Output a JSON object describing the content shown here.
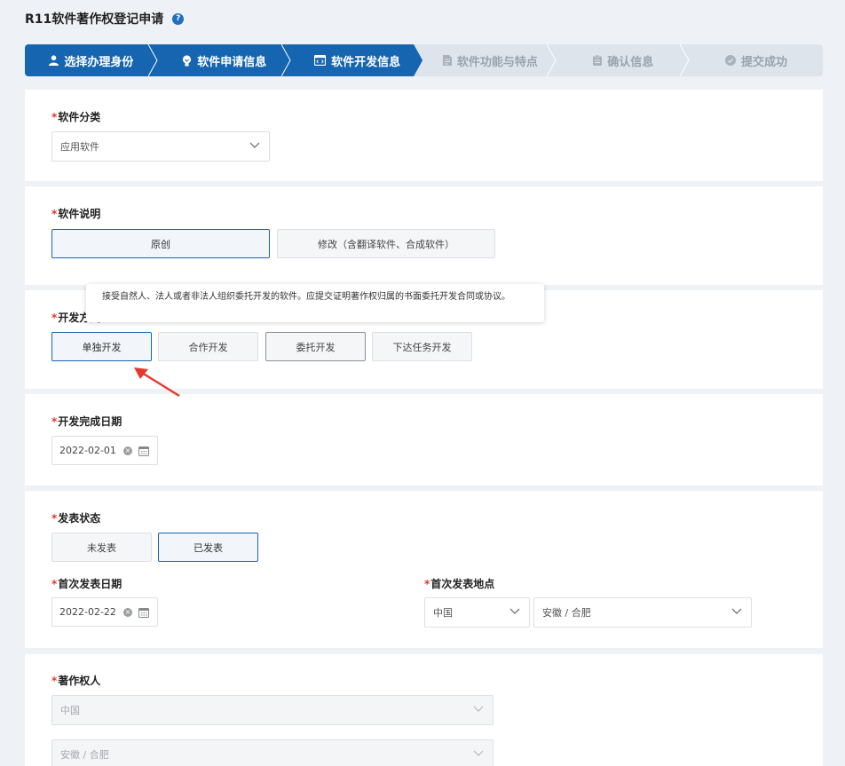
{
  "page": {
    "title": "R11软件著作权登记申请",
    "help_icon": "question-circle-icon"
  },
  "steps": [
    {
      "label": "选择办理身份",
      "icon": "user-icon",
      "state": "done"
    },
    {
      "label": "软件申请信息",
      "icon": "bulb-icon",
      "state": "done"
    },
    {
      "label": "软件开发信息",
      "icon": "code-window-icon",
      "state": "current"
    },
    {
      "label": "软件功能与特点",
      "icon": "document-icon",
      "state": "todo"
    },
    {
      "label": "确认信息",
      "icon": "clipboard-icon",
      "state": "todo"
    },
    {
      "label": "提交成功",
      "icon": "check-circle-icon",
      "state": "todo"
    }
  ],
  "sections": {
    "category": {
      "label": "软件分类",
      "value": "应用软件"
    },
    "description": {
      "label": "软件说明",
      "options": [
        "原创",
        "修改（含翻译软件、合成软件）"
      ],
      "selected": "原创"
    },
    "dev_method": {
      "label": "开发方式",
      "options": [
        "单独开发",
        "合作开发",
        "委托开发",
        "下达任务开发"
      ],
      "selected": "单独开发",
      "tooltip": "接受自然人、法人或者非法人组织委托开发的软件。应提交证明著作权归属的书面委托开发合同或协议。"
    },
    "completion_date": {
      "label": "开发完成日期",
      "value": "2022-02-01"
    },
    "publish_status": {
      "label": "发表状态",
      "options": [
        "未发表",
        "已发表"
      ],
      "selected": "已发表"
    },
    "first_publish_date": {
      "label": "首次发表日期",
      "value": "2022-02-22"
    },
    "first_publish_place": {
      "label": "首次发表地点",
      "country": "中国",
      "city": "安徽 / 合肥"
    },
    "copyright_owner": {
      "label": "著作权人",
      "country": "中国",
      "city": "安徽 / 合肥"
    }
  },
  "colors": {
    "primary": "#1565b0",
    "required": "#e2362b",
    "arrow": "#e8372c"
  }
}
